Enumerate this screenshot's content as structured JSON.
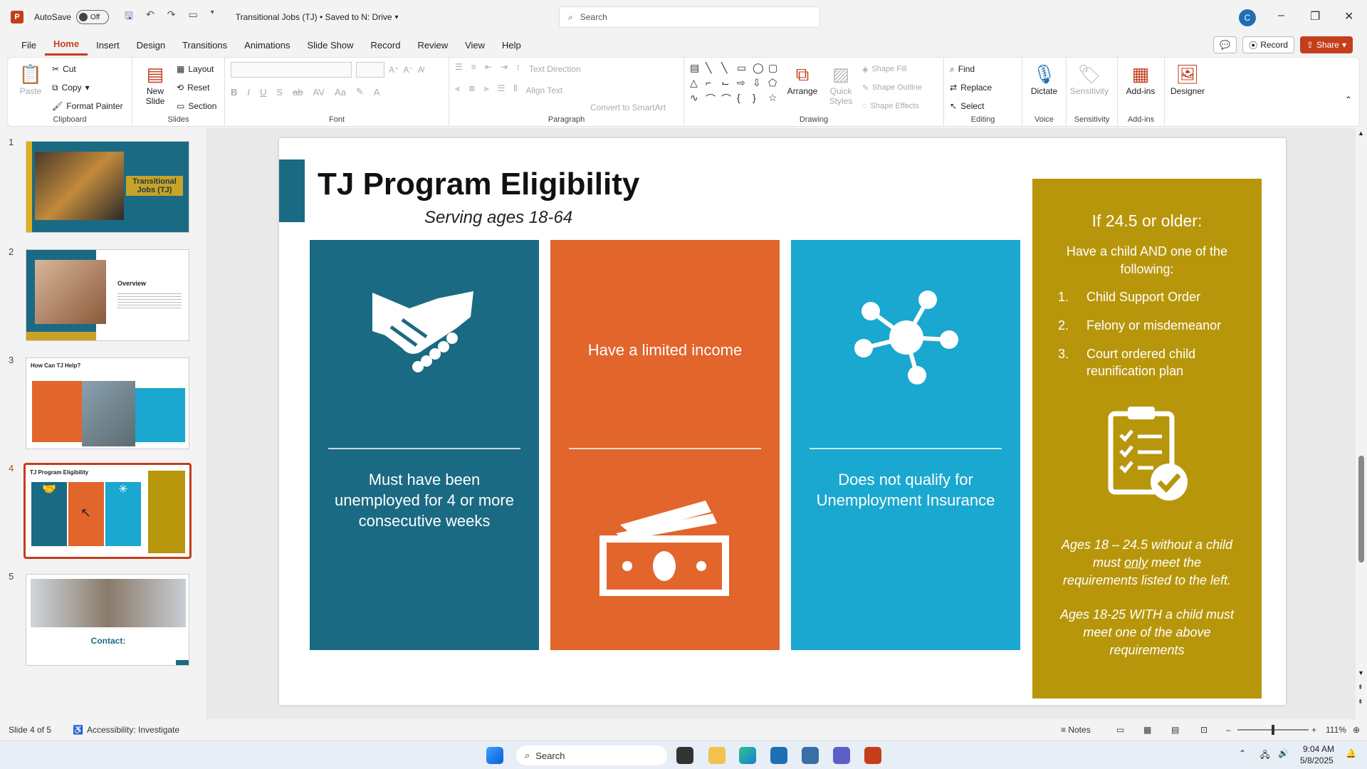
{
  "titlebar": {
    "autosave_label": "AutoSave",
    "autosave_state": "Off",
    "doc_title": "Transitional Jobs (TJ) • Saved to N: Drive",
    "search_placeholder": "Search",
    "user_initial": "C"
  },
  "menu": {
    "tabs": [
      "File",
      "Home",
      "Insert",
      "Design",
      "Transitions",
      "Animations",
      "Slide Show",
      "Record",
      "Review",
      "View",
      "Help"
    ],
    "active_tab": "Home",
    "record_label": "Record",
    "share_label": "Share"
  },
  "ribbon": {
    "clipboard": {
      "label": "Clipboard",
      "paste": "Paste",
      "cut": "Cut",
      "copy": "Copy",
      "format_painter": "Format Painter"
    },
    "slides": {
      "label": "Slides",
      "new_slide_line1": "New",
      "new_slide_line2": "Slide",
      "layout": "Layout",
      "reset": "Reset",
      "section": "Section"
    },
    "font": {
      "label": "Font"
    },
    "paragraph": {
      "label": "Paragraph",
      "text_direction": "Text Direction",
      "align_text": "Align Text",
      "convert_smartart": "Convert to SmartArt"
    },
    "drawing": {
      "label": "Drawing",
      "arrange": "Arrange",
      "quick_styles_line1": "Quick",
      "quick_styles_line2": "Styles",
      "shape_fill": "Shape Fill",
      "shape_outline": "Shape Outline",
      "shape_effects": "Shape Effects"
    },
    "editing": {
      "label": "Editing",
      "find": "Find",
      "replace": "Replace",
      "select": "Select"
    },
    "voice": {
      "label": "Voice",
      "dictate": "Dictate"
    },
    "sensitivity": {
      "label": "Sensitivity",
      "button": "Sensitivity"
    },
    "addins": {
      "label": "Add-ins",
      "button": "Add-ins"
    },
    "designer": {
      "button": "Designer"
    }
  },
  "thumbnails": {
    "numbers": [
      "1",
      "2",
      "3",
      "4",
      "5"
    ],
    "t1_title": "Transitional Jobs (TJ)",
    "t2_title": "Overview",
    "t3_title": "How Can TJ Help?",
    "t4_title": "TJ Program Eligibility",
    "t5_title": "Contact:"
  },
  "slide": {
    "title": "TJ Program Eligibility",
    "subtitle": "Serving ages 18-64",
    "panel1_text": "Must have been unemployed for 4 or more consecutive weeks",
    "panel2_text": "Have a limited income",
    "panel3_text": "Does not qualify for Unemployment Insurance",
    "gold": {
      "heading": "If 24.5 or older:",
      "intro": "Have a child AND one of the following:",
      "items": [
        {
          "num": "1.",
          "text": "Child Support Order"
        },
        {
          "num": "2.",
          "text": "Felony or misdemeanor"
        },
        {
          "num": "3.",
          "text": "Court ordered child reunification plan"
        }
      ],
      "note1_a": "Ages 18 – 24.5 without a child must ",
      "note1_b": "only",
      "note1_c": " meet the requirements listed to the left.",
      "note2": "Ages 18-25 WITH a child must meet one of the above requirements"
    },
    "colors": {
      "teal": "#1b6a84",
      "orange": "#e2652c",
      "cyan": "#1aa7d0",
      "gold": "#b8960b"
    }
  },
  "status": {
    "slide_info": "Slide 4 of 5",
    "accessibility": "Accessibility: Investigate",
    "notes": "Notes",
    "zoom": "111%"
  },
  "taskbar": {
    "search": "Search",
    "time": "9:04 AM",
    "date": "5/8/2025"
  }
}
